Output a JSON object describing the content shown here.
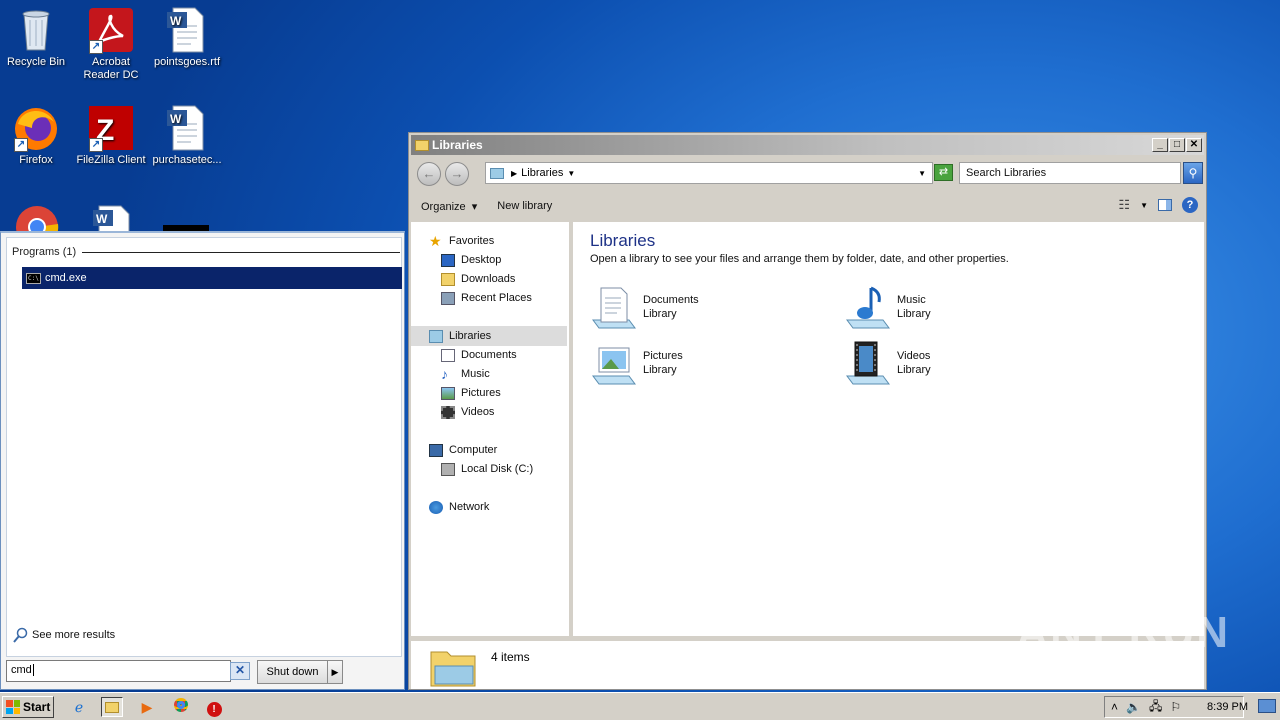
{
  "desktop": {
    "icons": [
      {
        "label": "Recycle Bin",
        "icon": "recycle-bin-icon"
      },
      {
        "label": "Acrobat Reader DC",
        "icon": "acrobat-icon"
      },
      {
        "label": "pointsgoes.rtf",
        "icon": "word-document-icon"
      },
      {
        "label": "Firefox",
        "icon": "firefox-icon"
      },
      {
        "label": "FileZilla Client",
        "icon": "filezilla-icon"
      },
      {
        "label": "purchasetec...",
        "icon": "word-document-icon"
      }
    ]
  },
  "start_menu": {
    "section_header": "Programs (1)",
    "results": [
      {
        "label": "cmd.exe",
        "icon": "cmd-icon"
      }
    ],
    "see_more": "See more results",
    "search_value": "cmd",
    "shutdown_label": "Shut down"
  },
  "explorer": {
    "window_title": "Libraries",
    "address_crumb": "Libraries",
    "search_placeholder": "Search Libraries",
    "toolbar": {
      "organize": "Organize",
      "new_library": "New library"
    },
    "nav": {
      "favorites": "Favorites",
      "desktop": "Desktop",
      "downloads": "Downloads",
      "recent": "Recent Places",
      "libraries": "Libraries",
      "documents": "Documents",
      "music": "Music",
      "pictures": "Pictures",
      "videos": "Videos",
      "computer": "Computer",
      "local_disk": "Local Disk (C:)",
      "network": "Network"
    },
    "heading": "Libraries",
    "subheading": "Open a library to see your files and arrange them by folder, date, and other properties.",
    "libraries": [
      {
        "name": "Documents",
        "type": "Library"
      },
      {
        "name": "Music",
        "type": "Library"
      },
      {
        "name": "Pictures",
        "type": "Library"
      },
      {
        "name": "Videos",
        "type": "Library"
      }
    ],
    "status": "4 items"
  },
  "watermark": "ANY RUN",
  "taskbar": {
    "start_label": "Start",
    "clock": "8:39 PM"
  },
  "colors": {
    "selection": "#0a246a",
    "title_text": "#1e3287",
    "desktop": "#1f6ed0"
  }
}
